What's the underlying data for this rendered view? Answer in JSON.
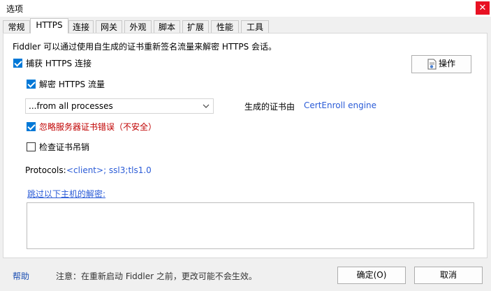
{
  "window": {
    "title": "选项",
    "close_glyph": "✕"
  },
  "tabs": [
    {
      "label": "常规"
    },
    {
      "label": "HTTPS"
    },
    {
      "label": "连接"
    },
    {
      "label": "网关"
    },
    {
      "label": "外观"
    },
    {
      "label": "脚本"
    },
    {
      "label": "扩展"
    },
    {
      "label": "性能"
    },
    {
      "label": "工具"
    }
  ],
  "active_tab": "HTTPS",
  "https": {
    "description": "Fiddler 可以通过使用自生成的证书重新签名流量来解密 HTTPS 会话。",
    "capture_label": "捕获 HTTPS 连接",
    "capture_checked": true,
    "actions_label": "操作",
    "decrypt_label": "解密 HTTPS 流量",
    "decrypt_checked": true,
    "process_filter_value": "...from all processes",
    "cert_generator_prefix": "生成的证书由",
    "cert_generator_link": "CertEnroll engine",
    "ignore_errors_label": "忽略服务器证书错误（不安全）",
    "ignore_errors_checked": true,
    "check_revocation_label": "检查证书吊销",
    "check_revocation_checked": false,
    "protocols_label": "Protocols:",
    "protocols_value": "<client>; ssl3;tls1.0",
    "skip_hosts_link": "跳过以下主机的解密:",
    "skip_hosts_value": ""
  },
  "footer": {
    "help_label": "帮助",
    "note": "注意：在重新启动 Fiddler 之前，更改可能不会生效。",
    "ok_label": "确定(O)",
    "cancel_label": "取消"
  }
}
